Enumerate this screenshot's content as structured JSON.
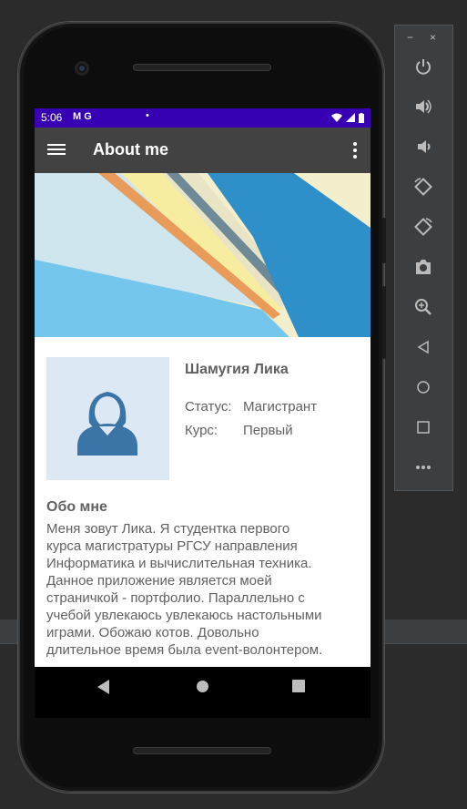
{
  "status_bar": {
    "time": "5:06",
    "left_icons": "M G",
    "dot": "•"
  },
  "app_bar": {
    "title": "About me"
  },
  "profile": {
    "name": "Шамугия Лика",
    "status_label": "Статус:",
    "status_value": "Магистрант",
    "course_label": "Курс:",
    "course_value": "Первый"
  },
  "about": {
    "heading": "Обо мне",
    "lines": [
      "Меня зовут Лика. Я студентка первого",
      "курса магистратуры РГСУ направления",
      "Информатика и вычислительная техника.",
      "Данное приложение является моей",
      "страничкой - портфолио. Параллельно с",
      "учебой увлекаюсь увлекаюсь настольными",
      "играми. Обожаю котов. Довольно",
      "длительное время была event-волонтером."
    ]
  },
  "emulator": {
    "minimize": "−",
    "close": "×",
    "buttons": [
      "power-icon",
      "volume-up-icon",
      "volume-down-icon",
      "rotate-left-icon",
      "rotate-right-icon",
      "camera-icon",
      "zoom-icon",
      "back-icon",
      "home-icon",
      "overview-icon",
      "more-icon"
    ]
  },
  "colors": {
    "status_bar": "#3700b3",
    "app_bar": "#424242",
    "avatar_bg": "#dce9f5",
    "avatar_figure": "#3b74a6"
  }
}
